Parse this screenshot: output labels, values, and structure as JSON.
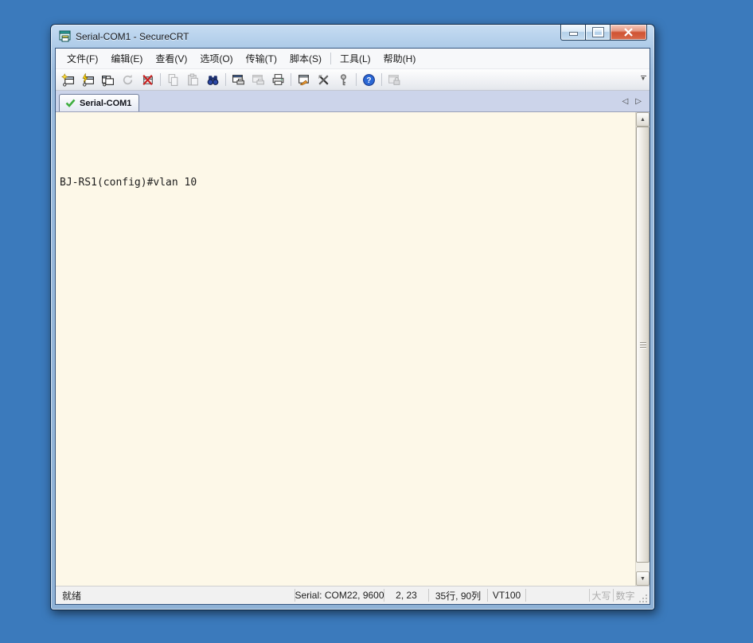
{
  "window": {
    "title": "Serial-COM1 - SecureCRT",
    "controls": {
      "minimize": "minimize",
      "maximize": "maximize",
      "close": "close"
    }
  },
  "menu": {
    "items": [
      {
        "label": "文件(F)"
      },
      {
        "label": "编辑(E)"
      },
      {
        "label": "查看(V)"
      },
      {
        "label": "选项(O)"
      },
      {
        "label": "传输(T)"
      },
      {
        "label": "脚本(S)"
      },
      {
        "label": "工具(L)"
      },
      {
        "label": "帮助(H)"
      }
    ]
  },
  "toolbar": {
    "buttons": [
      {
        "icon": "quick-connect-icon",
        "disabled": false
      },
      {
        "icon": "connect-icon",
        "disabled": false
      },
      {
        "icon": "connect-in-tab-icon",
        "disabled": false
      },
      {
        "icon": "reconnect-icon",
        "disabled": true
      },
      {
        "icon": "disconnect-icon",
        "disabled": false
      },
      {
        "icon": "copy-icon",
        "disabled": true
      },
      {
        "icon": "paste-icon",
        "disabled": true
      },
      {
        "icon": "find-icon",
        "disabled": false
      },
      {
        "icon": "print-screen-icon",
        "disabled": false
      },
      {
        "icon": "print-selection-icon",
        "disabled": true
      },
      {
        "icon": "print-icon",
        "disabled": false
      },
      {
        "icon": "session-options-icon",
        "disabled": false
      },
      {
        "icon": "global-options-icon",
        "disabled": false
      },
      {
        "icon": "keymap-icon",
        "disabled": false
      },
      {
        "icon": "help-icon",
        "disabled": false
      },
      {
        "icon": "lock-session-icon",
        "disabled": true
      }
    ]
  },
  "tabs": [
    {
      "label": "Serial-COM1",
      "status_icon": "connected-check-icon"
    }
  ],
  "terminal": {
    "lines": [
      "",
      "BJ-RS1(config)#vlan 10"
    ]
  },
  "status_bar": {
    "ready": "就绪",
    "serial": "Serial: COM22, 9600",
    "cursor_position": "2, 23",
    "screen_size": "35行, 90列",
    "emulation": "VT100",
    "caps": "大写",
    "num": "数字"
  },
  "colors": {
    "desktop": "#3b7abc",
    "titlebar": "#aecbe8",
    "tabbar": "#ccd4ea",
    "terminal_bg": "#fdf8e8",
    "terminal_text": "#1d1d1d",
    "close_button": "#cf5333",
    "tab_check": "#3fae3f"
  }
}
